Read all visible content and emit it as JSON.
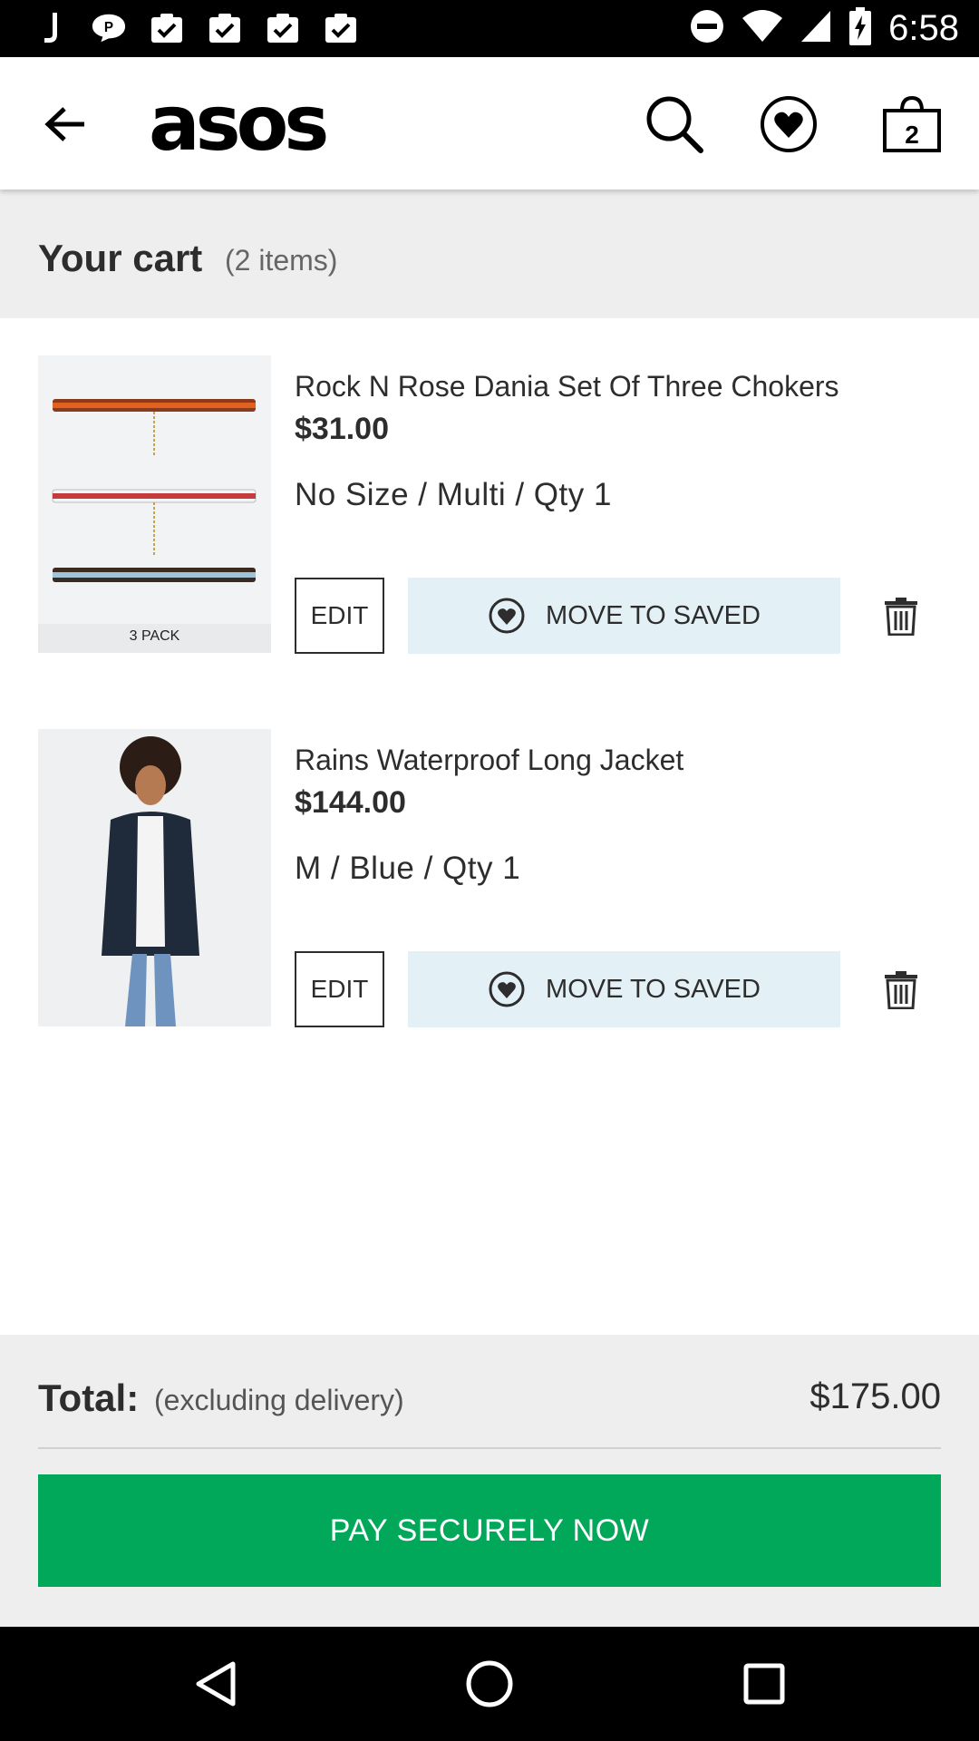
{
  "status_bar": {
    "time": "6:58",
    "left_icons": [
      "j-app-icon",
      "chat-icon",
      "clipboard-check-icon",
      "clipboard-check-icon",
      "clipboard-check-icon",
      "clipboard-check-icon"
    ],
    "right_icons": [
      "do-not-disturb-icon",
      "wifi-icon",
      "cell-signal-icon",
      "battery-charging-icon"
    ]
  },
  "header": {
    "logo": "asos",
    "bag_count": "2",
    "icons": [
      "back-arrow-icon",
      "search-icon",
      "heart-icon",
      "bag-icon"
    ]
  },
  "cart": {
    "title": "Your cart",
    "count_text": "(2 items)"
  },
  "items": [
    {
      "name": "Rock N Rose Dania Set Of Three Chokers",
      "price": "$31.00",
      "variant": "No Size / Multi / Qty 1",
      "image_caption": "3 PACK",
      "edit_label": "EDIT",
      "move_label": "MOVE TO SAVED"
    },
    {
      "name": "Rains Waterproof Long Jacket",
      "price": "$144.00",
      "variant": "M / Blue / Qty 1",
      "edit_label": "EDIT",
      "move_label": "MOVE TO SAVED"
    }
  ],
  "footer": {
    "total_label": "Total:",
    "total_note": "(excluding delivery)",
    "total_value": "$175.00",
    "pay_label": "PAY SECURELY NOW"
  },
  "colors": {
    "pay_button": "#01a85a",
    "move_button_bg": "#e3f1f7",
    "band_bg": "#eeeeee"
  },
  "nav_bar": {
    "icons": [
      "nav-back-icon",
      "nav-home-icon",
      "nav-recents-icon"
    ]
  }
}
